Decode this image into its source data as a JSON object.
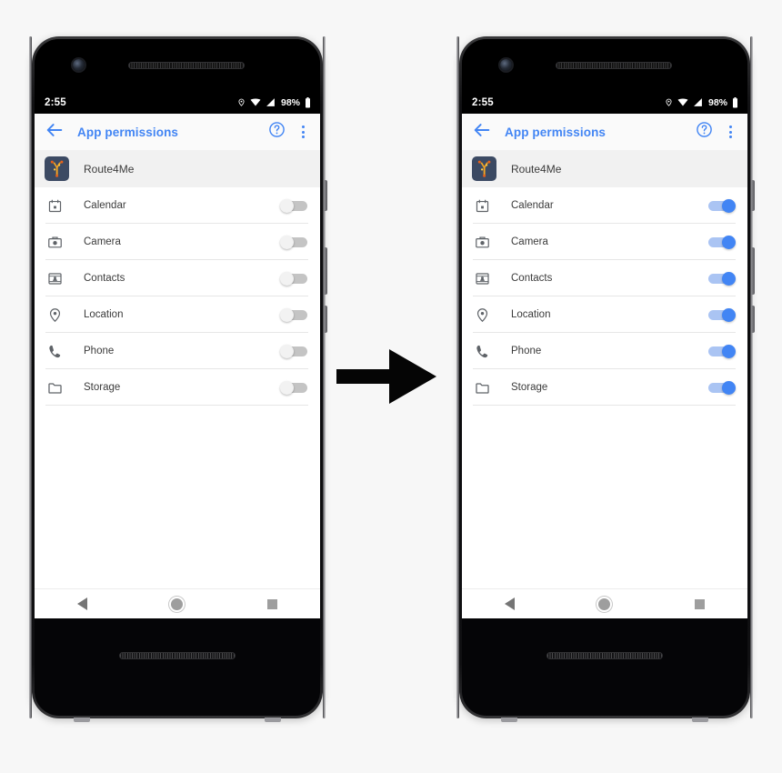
{
  "background_color": "#f7f7f7",
  "accent_color": "#4285f4",
  "arrow": {
    "name": "transition-arrow",
    "direction": "right",
    "color": "#000000"
  },
  "phones": [
    {
      "id": "before",
      "status_bar": {
        "time": "2:55",
        "battery_percent": "98%",
        "icons": [
          "location-icon",
          "wifi-icon",
          "signal-icon",
          "battery-icon"
        ]
      },
      "app_bar": {
        "title": "App permissions",
        "back_label": "Back",
        "help_label": "Help",
        "menu_label": "More options"
      },
      "app": {
        "name": "Route4Me",
        "icon_color": "#3c4a63",
        "glyph_color": "#f5a623"
      },
      "permissions": [
        {
          "label": "Calendar",
          "icon": "calendar-icon",
          "enabled": false
        },
        {
          "label": "Camera",
          "icon": "camera-icon",
          "enabled": false
        },
        {
          "label": "Contacts",
          "icon": "contacts-icon",
          "enabled": false
        },
        {
          "label": "Location",
          "icon": "location-pin-icon",
          "enabled": false
        },
        {
          "label": "Phone",
          "icon": "phone-icon",
          "enabled": false
        },
        {
          "label": "Storage",
          "icon": "folder-icon",
          "enabled": false
        }
      ],
      "nav_bar": {
        "back": "Back",
        "home": "Home",
        "recents": "Recents"
      }
    },
    {
      "id": "after",
      "status_bar": {
        "time": "2:55",
        "battery_percent": "98%",
        "icons": [
          "location-icon",
          "wifi-icon",
          "signal-icon",
          "battery-icon"
        ]
      },
      "app_bar": {
        "title": "App permissions",
        "back_label": "Back",
        "help_label": "Help",
        "menu_label": "More options"
      },
      "app": {
        "name": "Route4Me",
        "icon_color": "#3c4a63",
        "glyph_color": "#f5a623"
      },
      "permissions": [
        {
          "label": "Calendar",
          "icon": "calendar-icon",
          "enabled": true
        },
        {
          "label": "Camera",
          "icon": "camera-icon",
          "enabled": true
        },
        {
          "label": "Contacts",
          "icon": "contacts-icon",
          "enabled": true
        },
        {
          "label": "Location",
          "icon": "location-pin-icon",
          "enabled": true
        },
        {
          "label": "Phone",
          "icon": "phone-icon",
          "enabled": true
        },
        {
          "label": "Storage",
          "icon": "folder-icon",
          "enabled": true
        }
      ],
      "nav_bar": {
        "back": "Back",
        "home": "Home",
        "recents": "Recents"
      }
    }
  ]
}
